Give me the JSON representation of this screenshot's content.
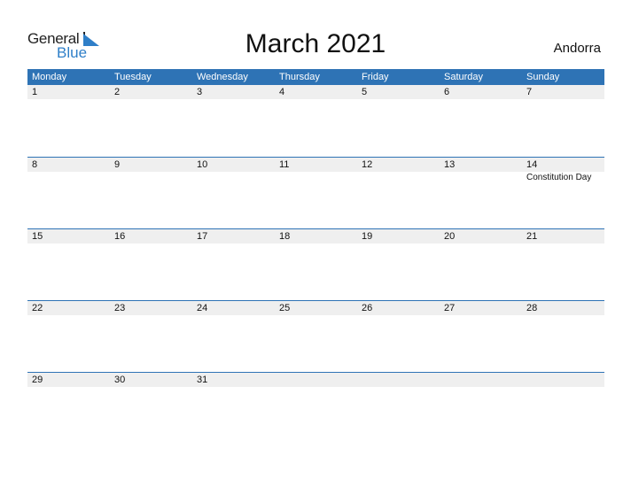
{
  "logo": {
    "text1": "General",
    "text2": "Blue"
  },
  "title": "March 2021",
  "country": "Andorra",
  "colors": {
    "accent": "#2e73b5",
    "band": "#efefef"
  },
  "weekdays": [
    "Monday",
    "Tuesday",
    "Wednesday",
    "Thursday",
    "Friday",
    "Saturday",
    "Sunday"
  ],
  "weeks": [
    {
      "days": [
        "1",
        "2",
        "3",
        "4",
        "5",
        "6",
        "7"
      ],
      "events": [
        "",
        "",
        "",
        "",
        "",
        "",
        ""
      ]
    },
    {
      "days": [
        "8",
        "9",
        "10",
        "11",
        "12",
        "13",
        "14"
      ],
      "events": [
        "",
        "",
        "",
        "",
        "",
        "",
        "Constitution Day"
      ]
    },
    {
      "days": [
        "15",
        "16",
        "17",
        "18",
        "19",
        "20",
        "21"
      ],
      "events": [
        "",
        "",
        "",
        "",
        "",
        "",
        ""
      ]
    },
    {
      "days": [
        "22",
        "23",
        "24",
        "25",
        "26",
        "27",
        "28"
      ],
      "events": [
        "",
        "",
        "",
        "",
        "",
        "",
        ""
      ]
    },
    {
      "days": [
        "29",
        "30",
        "31",
        "",
        "",
        "",
        ""
      ],
      "events": [
        "",
        "",
        "",
        "",
        "",
        "",
        ""
      ]
    }
  ]
}
